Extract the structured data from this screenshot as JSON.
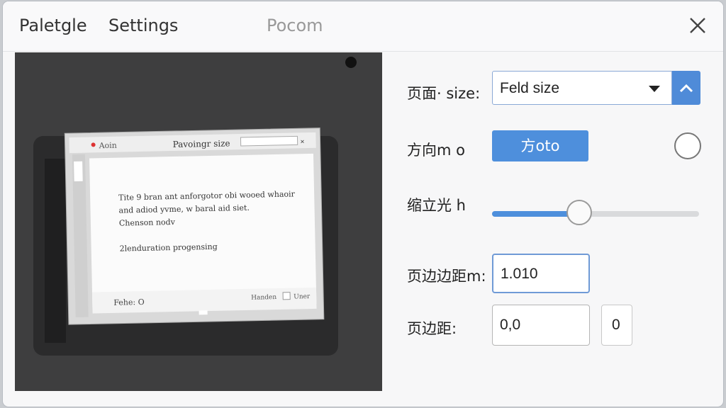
{
  "titlebar": {
    "tabs": [
      "Paletgle",
      "Settings",
      "Pocom"
    ]
  },
  "preview": {
    "dialog_title": "Pavoingr size",
    "dialog_left_label": "Aoin",
    "body_lines": [
      "Tite 9 bran ant anforgotor obi wooed whaoir",
      "and adiod yvme, w baral aid siet.",
      "Chenson nodv",
      "2lenduration progensing"
    ],
    "footer_left": "Fehe: O",
    "footer_right": "Handen",
    "footer_btn": "Uner"
  },
  "settings": {
    "page_size_label": "页面· size:",
    "page_size_value": "Feld size",
    "orientation_label": "方向m o",
    "orientation_button": "方oto",
    "zoom_label": "缩立光 h",
    "zoom_fraction": 0.42,
    "margin_label": "页边边距m:",
    "margin_value": "1.010",
    "margin2_label": "页边距:",
    "margin2_value": "0,0",
    "margin2_extra": "0"
  },
  "colors": {
    "accent": "#4e8fdc",
    "preview_bg": "#3e3e3f"
  },
  "icons": {
    "close": "close-icon",
    "caret": "chevron-down-icon",
    "up": "chevron-up-icon"
  }
}
